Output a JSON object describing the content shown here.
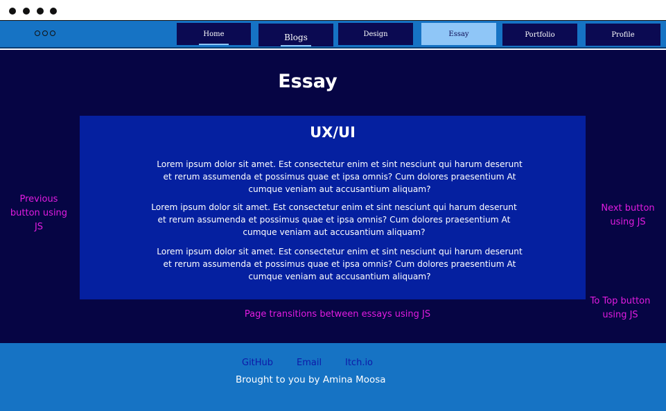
{
  "titlebar": {
    "dots": [
      "dot",
      "dot",
      "dot",
      "dot"
    ]
  },
  "nav": {
    "menu_icon": "ellipsis-icon",
    "items": [
      {
        "label": "Home"
      },
      {
        "label": "Blogs"
      },
      {
        "label": "Design"
      },
      {
        "label": "Essay",
        "active": true
      },
      {
        "label": "Portfolio"
      },
      {
        "label": "Profile"
      }
    ]
  },
  "main": {
    "title": "Essay",
    "card": {
      "title": "UX/UI",
      "paragraphs": [
        "Lorem ipsum dolor sit amet. Est consectetur enim et sint nesciunt qui harum deserunt et rerum assumenda et possimus quae et ipsa omnis? Cum dolores praesentium At cumque veniam aut accusantium aliquam?",
        "Lorem ipsum dolor sit amet. Est consectetur enim et sint nesciunt qui harum deserunt et rerum assumenda et possimus quae et ipsa omnis? Cum dolores praesentium At cumque veniam aut accusantium aliquam?",
        "Lorem ipsum dolor sit amet. Est consectetur enim et sint nesciunt qui harum deserunt et rerum assumenda et possimus quae et ipsa omnis? Cum dolores praesentium At cumque veniam aut accusantium aliquam?"
      ]
    },
    "annotations": {
      "previous": "Previous button using JS",
      "next": "Next button using JS",
      "transitions": "Page transitions between essays using JS",
      "to_top": "To Top button using JS"
    }
  },
  "footer": {
    "links": [
      "GitHub",
      "Email",
      "Itch.io"
    ],
    "credit": "Brought to you by Amina Moosa"
  },
  "colors": {
    "nav_bg": "#1673c4",
    "nav_button": "#0b0a52",
    "nav_active": "#8fc6f7",
    "page_bg": "#060544",
    "card_bg": "#0520a0",
    "annotation": "#e21ce0",
    "footer_link": "#0d1aa8"
  }
}
